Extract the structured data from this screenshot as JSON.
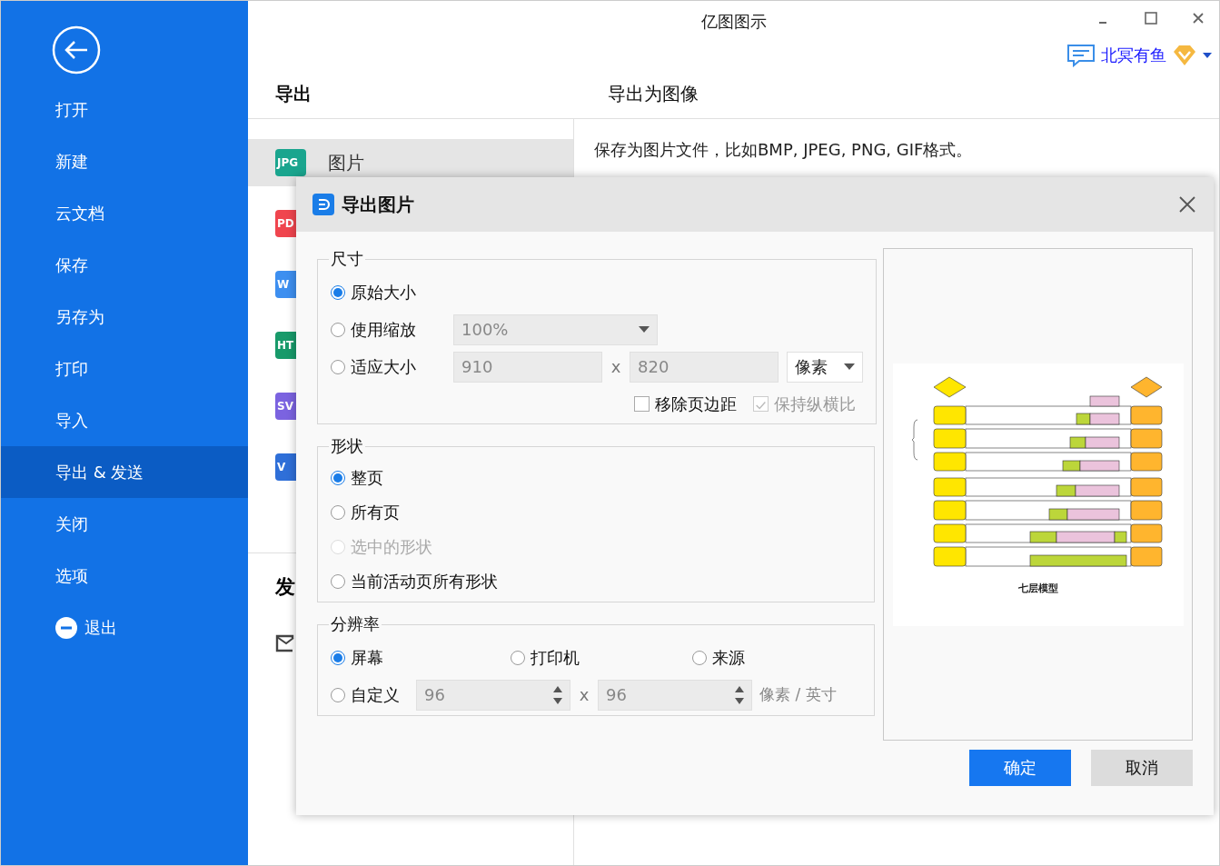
{
  "window": {
    "title": "亿图图示"
  },
  "sidebar": {
    "items": [
      {
        "label": "打开",
        "kind": "plain",
        "selected": false
      },
      {
        "label": "新建",
        "kind": "plain",
        "selected": false
      },
      {
        "label": "云文档",
        "kind": "plain",
        "selected": false
      },
      {
        "label": "保存",
        "kind": "plain",
        "selected": false
      },
      {
        "label": "另存为",
        "kind": "plain",
        "selected": false
      },
      {
        "label": "打印",
        "kind": "plain",
        "selected": false
      },
      {
        "label": "导入",
        "kind": "plain",
        "selected": false
      },
      {
        "label": "导出 & 发送",
        "kind": "plain",
        "selected": true
      },
      {
        "label": "关闭",
        "kind": "plain",
        "selected": false
      },
      {
        "label": "选项",
        "kind": "plain",
        "selected": false
      },
      {
        "label": "退出",
        "kind": "exit",
        "selected": false
      }
    ]
  },
  "user": {
    "name": "北冥有鱼"
  },
  "header": {
    "section": "导出",
    "panel_title": "导出为图像"
  },
  "formats": [
    {
      "badge": "JPG",
      "label": "图片",
      "color": "#1aa58e",
      "selected": true
    },
    {
      "badge": "PD",
      "color": "#f0454e",
      "selected": false
    },
    {
      "badge": "W",
      "color": "#3d8ff0",
      "selected": false
    },
    {
      "badge": "HT",
      "color": "#189a6a",
      "selected": false
    },
    {
      "badge": "SV",
      "color": "#7b63e0",
      "selected": false
    },
    {
      "badge": "V",
      "color": "#2f6fd8",
      "selected": false
    }
  ],
  "description": "保存为图片文件，比如BMP, JPEG, PNG, GIF格式。",
  "send": {
    "heading": "发"
  },
  "dialog": {
    "title": "导出图片",
    "size": {
      "legend": "尺寸",
      "options": [
        {
          "label": "原始大小",
          "selected": true,
          "disabled": false
        },
        {
          "label": "使用缩放",
          "selected": false,
          "disabled": false
        },
        {
          "label": "适应大小",
          "selected": false,
          "disabled": false
        }
      ],
      "scale": {
        "value": "100%",
        "disabled": true
      },
      "width": {
        "value": "910",
        "disabled": true
      },
      "separator": "x",
      "height": {
        "value": "820",
        "disabled": true
      },
      "unit": "像素",
      "checks": [
        {
          "label": "移除页边距",
          "checked": false,
          "disabled": false
        },
        {
          "label": "保持纵横比",
          "checked": true,
          "disabled": true
        }
      ]
    },
    "shape": {
      "legend": "形状",
      "options": [
        {
          "label": "整页",
          "selected": true,
          "disabled": false
        },
        {
          "label": "所有页",
          "selected": false,
          "disabled": false
        },
        {
          "label": "选中的形状",
          "selected": false,
          "disabled": true
        },
        {
          "label": "当前活动页所有形状",
          "selected": false,
          "disabled": false
        }
      ]
    },
    "resolution": {
      "legend": "分辨率",
      "options": [
        {
          "label": "屏幕",
          "selected": true,
          "disabled": false
        },
        {
          "label": "打印机",
          "selected": false,
          "disabled": false
        },
        {
          "label": "来源",
          "selected": false,
          "disabled": false
        },
        {
          "label": "自定义",
          "selected": false,
          "disabled": false
        }
      ],
      "x_dpi": {
        "value": "96",
        "disabled": true
      },
      "separator": "x",
      "y_dpi": {
        "value": "96",
        "disabled": true
      },
      "unit": {
        "label": "像素 / 英寸",
        "disabled": true
      }
    },
    "preview": {
      "caption": "七层模型"
    },
    "buttons": [
      {
        "label": "确定",
        "kind": "primary"
      },
      {
        "label": "取消",
        "kind": "secondary"
      }
    ]
  }
}
